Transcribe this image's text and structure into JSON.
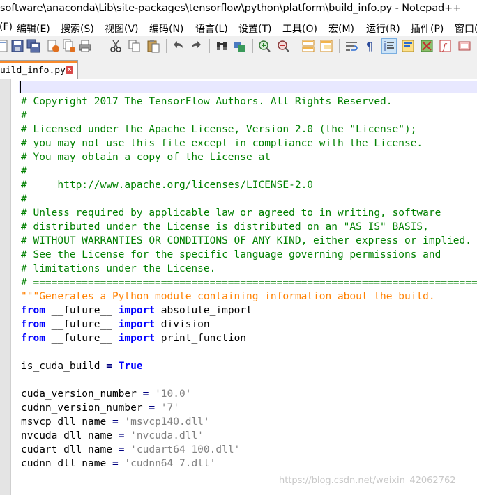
{
  "window": {
    "title": "software\\anaconda\\Lib\\site-packages\\tensorflow\\python\\platform\\build_info.py - Notepad++"
  },
  "menu": {
    "items": [
      "(F)",
      "编辑(E)",
      "搜索(S)",
      "视图(V)",
      "编码(N)",
      "语言(L)",
      "设置(T)",
      "工具(O)",
      "宏(M)",
      "运行(R)",
      "插件(P)",
      "窗口("
    ]
  },
  "toolbar": {
    "icons": [
      "new-file-icon",
      "open-file-icon",
      "save-icon",
      "save-all-icon",
      "close-icon",
      "close-all-icon",
      "print-icon",
      "cut-icon",
      "copy-icon",
      "paste-icon",
      "undo-icon",
      "redo-icon",
      "find-icon",
      "replace-icon",
      "zoom-in-icon",
      "zoom-out-icon",
      "sync-vertical-icon",
      "sync-horizontal-icon",
      "word-wrap-icon",
      "show-all-chars-icon",
      "indent-guide-icon",
      "document-map-icon",
      "function-list-icon",
      "folder-workspace-icon",
      "monitor-icon"
    ]
  },
  "tab": {
    "label": "uild_info.py",
    "close_glyph": "x"
  },
  "code": {
    "l01": "",
    "l02": "# Copyright 2017 The TensorFlow Authors. All Rights Reserved.",
    "l03": "#",
    "l04": "# Licensed under the Apache License, Version 2.0 (the \"License\");",
    "l05": "# you may not use this file except in compliance with the License.",
    "l06": "# You may obtain a copy of the License at",
    "l07": "#",
    "l08_prefix": "#     ",
    "l08_link": "http://www.apache.org/licenses/LICENSE-2.0",
    "l09": "#",
    "l10": "# Unless required by applicable law or agreed to in writing, software",
    "l11": "# distributed under the License is distributed on an \"AS IS\" BASIS,",
    "l12": "# WITHOUT WARRANTIES OR CONDITIONS OF ANY KIND, either express or implied.",
    "l13": "# See the License for the specific language governing permissions and",
    "l14": "# limitations under the License.",
    "l15": "# ==============================================================================",
    "l16": "\"\"\"Generates a Python module containing information about the build.",
    "from_kw": "from",
    "future_mod": " __future__ ",
    "import_kw": "import",
    "l17_name": " absolute_import",
    "l18_name": " division",
    "l19_name": " print_function",
    "l21_var": "is_cuda_build ",
    "eq": "=",
    "l21_val": "True",
    "l23_var": "cuda_version_number ",
    "l23_val": "'10.0'",
    "l24_var": "cudnn_version_number ",
    "l24_val": "'7'",
    "l25_var": "msvcp_dll_name ",
    "l25_val": "'msvcp140.dll'",
    "l26_var": "nvcuda_dll_name ",
    "l26_val": "'nvcuda.dll'",
    "l27_var": "cudart_dll_name ",
    "l27_val": "'cudart64_100.dll'",
    "l28_var": "cudnn_dll_name ",
    "l28_val": "'cudnn64_7.dll'"
  },
  "watermark": "https://blog.csdn.net/weixin_42062762"
}
